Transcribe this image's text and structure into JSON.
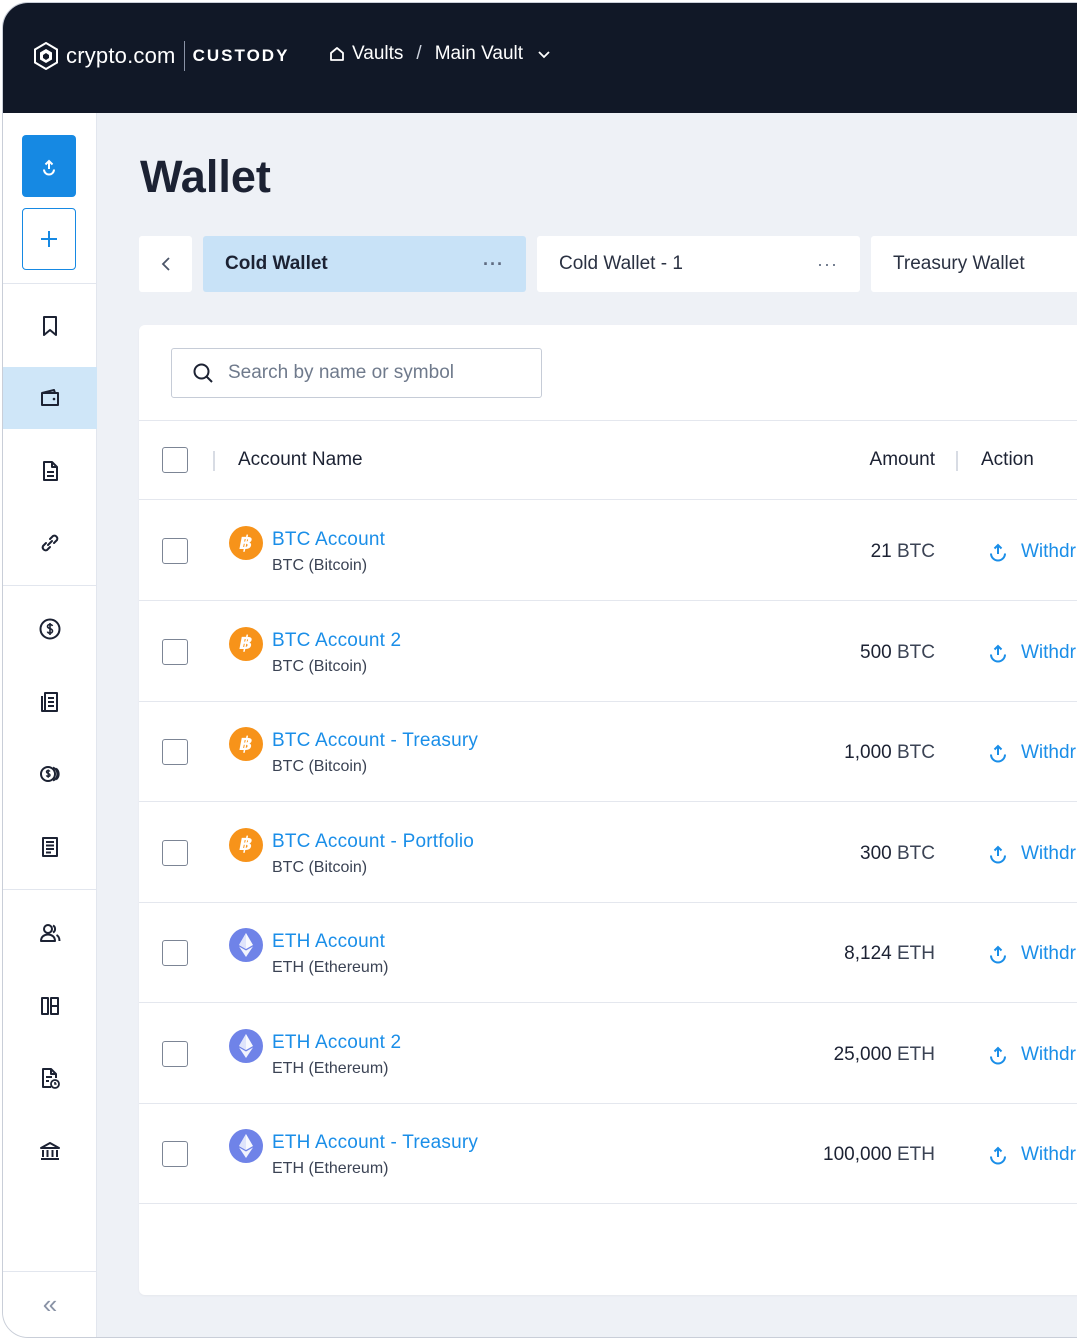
{
  "header": {
    "brand_name": "crypto.com",
    "brand_product": "CUSTODY",
    "breadcrumb": {
      "first": "Vaults",
      "separator": "/",
      "second": "Main Vault"
    }
  },
  "sidebar": {
    "items": [
      {
        "icon": "upload-icon"
      },
      {
        "icon": "plus-icon"
      },
      {
        "icon": "bookmark-icon"
      },
      {
        "icon": "wallet-icon",
        "active": true
      },
      {
        "icon": "document-icon"
      },
      {
        "icon": "link-icon"
      },
      {
        "icon": "dollar-circle-icon"
      },
      {
        "icon": "ledger-icon"
      },
      {
        "icon": "coins-icon"
      },
      {
        "icon": "report-icon"
      },
      {
        "icon": "users-icon"
      },
      {
        "icon": "columns-icon"
      },
      {
        "icon": "document-clock-icon"
      },
      {
        "icon": "bank-icon"
      }
    ],
    "collapse": "«"
  },
  "page": {
    "title": "Wallet"
  },
  "tabs": [
    {
      "label": "Cold Wallet",
      "more": "···",
      "active": true
    },
    {
      "label": "Cold Wallet - 1",
      "more": "···",
      "active": false
    },
    {
      "label": "Treasury Wallet",
      "more": "",
      "active": false
    }
  ],
  "search": {
    "placeholder": "Search by name or symbol",
    "value": ""
  },
  "table": {
    "headers": {
      "account_name": "Account Name",
      "amount": "Amount",
      "action": "Action"
    },
    "rows": [
      {
        "name": "BTC Account",
        "asset": "BTC (Bitcoin)",
        "coin": "BTC",
        "amount": "21",
        "unit": "BTC",
        "action": "Withdr"
      },
      {
        "name": "BTC Account 2",
        "asset": "BTC (Bitcoin)",
        "coin": "BTC",
        "amount": "500",
        "unit": "BTC",
        "action": "Withdr"
      },
      {
        "name": "BTC Account - Treasury",
        "asset": "BTC (Bitcoin)",
        "coin": "BTC",
        "amount": "1,000",
        "unit": "BTC",
        "action": "Withdr"
      },
      {
        "name": "BTC Account - Portfolio",
        "asset": "BTC (Bitcoin)",
        "coin": "BTC",
        "amount": "300",
        "unit": "BTC",
        "action": "Withdr"
      },
      {
        "name": "ETH Account",
        "asset": "ETH (Ethereum)",
        "coin": "ETH",
        "amount": "8,124",
        "unit": "ETH",
        "action": "Withdr"
      },
      {
        "name": "ETH Account 2",
        "asset": "ETH (Ethereum)",
        "coin": "ETH",
        "amount": "25,000",
        "unit": "ETH",
        "action": "Withdr"
      },
      {
        "name": "ETH Account - Treasury",
        "asset": "ETH (Ethereum)",
        "coin": "ETH",
        "amount": "100,000",
        "unit": "ETH",
        "action": "Withdr"
      }
    ]
  },
  "colors": {
    "accent": "#1689e3",
    "link": "#1a8ee8",
    "topbar": "#111827",
    "btc": "#f7931a",
    "eth": "#6f83e8"
  }
}
